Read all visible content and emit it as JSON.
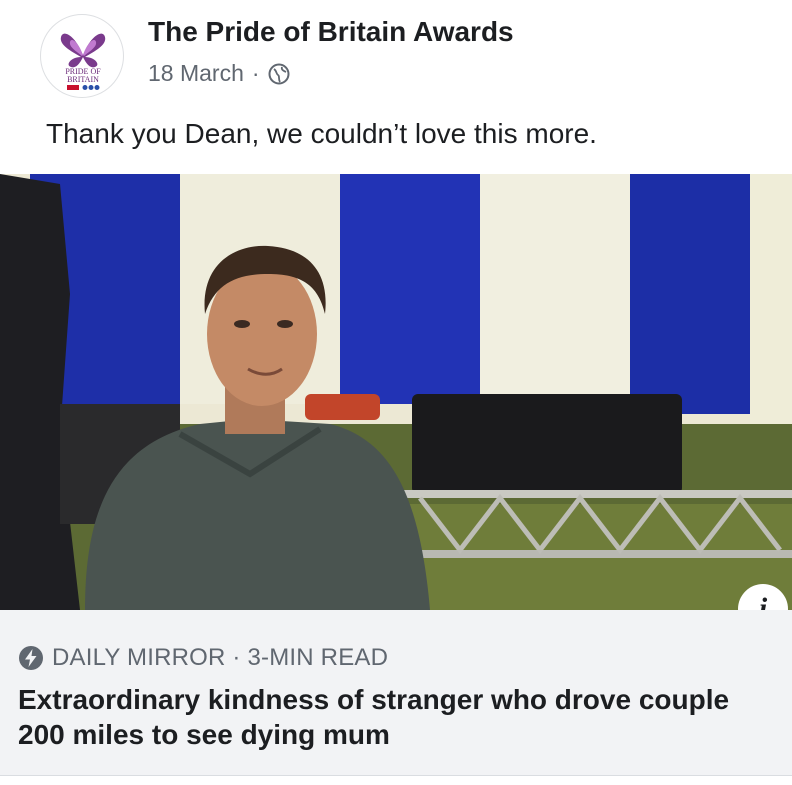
{
  "post": {
    "page_name": "The Pride of Britain Awards",
    "date": "18 March",
    "separator": "·",
    "privacy_icon": "globe-icon",
    "caption": "Thank you Dean, we couldn’t love this more.",
    "logo_text_line1": "PRIDE OF",
    "logo_text_line2": "BRITAIN"
  },
  "link_preview": {
    "source_icon": "lightning-bolt-icon",
    "source": "DAILY MIRROR · 3-MIN READ",
    "headline": "Extraordinary kindness of stranger who drove couple 200 miles to see dying mum",
    "info_label": "i"
  },
  "colors": {
    "text_primary": "#1c1e21",
    "text_secondary": "#606770",
    "link_bg": "#f2f3f5",
    "tent_blue": "#1e2fa8",
    "logo_purple": "#6b2a7a"
  }
}
